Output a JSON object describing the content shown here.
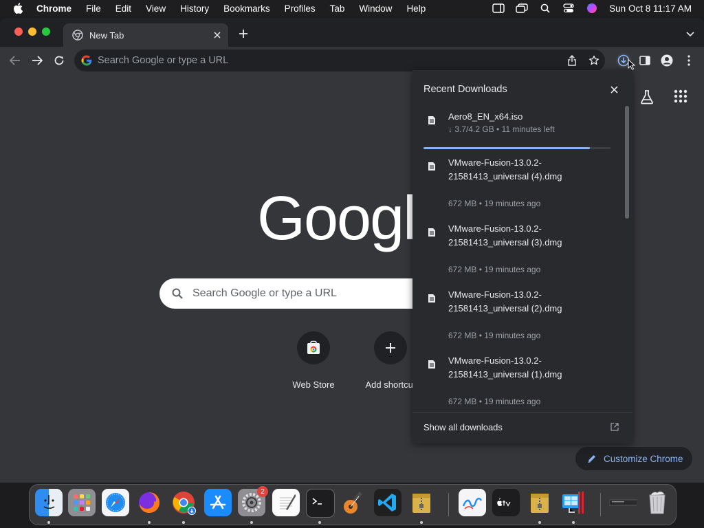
{
  "menubar": {
    "app_name": "Chrome",
    "items": [
      "File",
      "Edit",
      "View",
      "History",
      "Bookmarks",
      "Profiles",
      "Tab",
      "Window",
      "Help"
    ],
    "clock": "Sun Oct 8  11:17 AM"
  },
  "tab": {
    "title": "New Tab"
  },
  "omnibox": {
    "placeholder": "Search Google or type a URL"
  },
  "ntp": {
    "logo_text": "Google",
    "search_placeholder": "Search Google or type a URL",
    "shortcuts": [
      {
        "label": "Web Store"
      },
      {
        "label": "Add shortcut"
      }
    ],
    "customize_label": "Customize Chrome"
  },
  "downloads": {
    "title": "Recent Downloads",
    "items": [
      {
        "name": "Aero8_EN_x64.iso",
        "status": "↓ 3.7/4.2 GB • 11 minutes left",
        "progress": 0.89
      },
      {
        "name": "VMware-Fusion-13.0.2-21581413_universal (4).dmg",
        "status": "672 MB • 19 minutes ago"
      },
      {
        "name": "VMware-Fusion-13.0.2-21581413_universal (3).dmg",
        "status": "672 MB • 19 minutes ago"
      },
      {
        "name": "VMware-Fusion-13.0.2-21581413_universal (2).dmg",
        "status": "672 MB • 19 minutes ago"
      },
      {
        "name": "VMware-Fusion-13.0.2-21581413_universal (1).dmg",
        "status": "672 MB • 19 minutes ago"
      }
    ],
    "footer_label": "Show all downloads"
  },
  "dock": {
    "settings_badge": "2"
  },
  "colors": {
    "accent": "#8ab4f8",
    "panel_bg": "#292a2d",
    "toolbar_bg": "#35363a"
  }
}
